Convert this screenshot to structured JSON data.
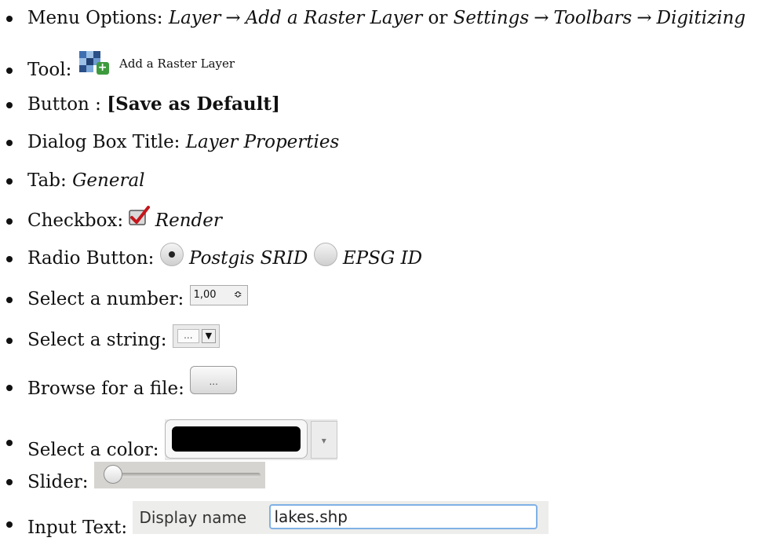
{
  "items": [
    {
      "label": "Menu Options:",
      "path1": [
        "Layer",
        "Add a Raster Layer"
      ],
      "or": "or",
      "path2": [
        "Settings",
        "Toolbars",
        "Digitizing"
      ],
      "arrow": "→"
    },
    {
      "label": "Tool:",
      "tool_name": "Add a Raster Layer",
      "icon": "add-raster-layer-icon"
    },
    {
      "label": "Button :",
      "button_text": "[Save as Default]"
    },
    {
      "label": "Dialog Box Title:",
      "value": "Layer Properties"
    },
    {
      "label": "Tab:",
      "value": "General"
    },
    {
      "label": "Checkbox:",
      "value": "Render",
      "checked": true
    },
    {
      "label": "Radio Button:",
      "option1": "Postgis SRID",
      "option2": "EPSG ID",
      "selected": "Postgis SRID"
    },
    {
      "label": "Select a number:",
      "value": "1,00",
      "arrow": "≎"
    },
    {
      "label": "Select a string:",
      "value": "...",
      "arrow": "▼"
    },
    {
      "label": "Browse for a file:",
      "button_text": "..."
    },
    {
      "label": "Select a color:",
      "color": "#000000",
      "arrow": "▾"
    },
    {
      "label": "Slider:",
      "level": 0
    },
    {
      "label": "Input Text:",
      "field_label": "Display name",
      "value": "lakes.shp"
    }
  ]
}
